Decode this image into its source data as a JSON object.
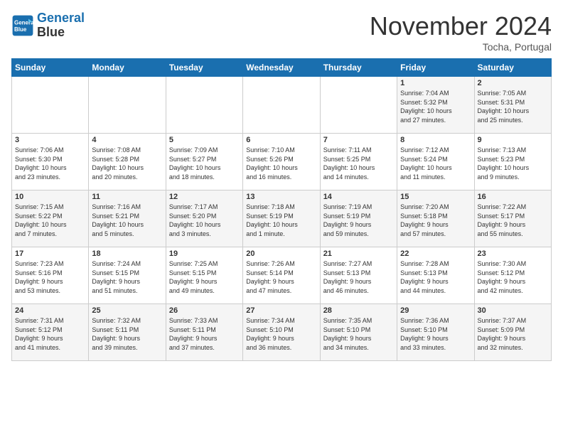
{
  "logo": {
    "line1": "General",
    "line2": "Blue"
  },
  "title": "November 2024",
  "location": "Tocha, Portugal",
  "days_of_week": [
    "Sunday",
    "Monday",
    "Tuesday",
    "Wednesday",
    "Thursday",
    "Friday",
    "Saturday"
  ],
  "weeks": [
    [
      {
        "day": "",
        "info": ""
      },
      {
        "day": "",
        "info": ""
      },
      {
        "day": "",
        "info": ""
      },
      {
        "day": "",
        "info": ""
      },
      {
        "day": "",
        "info": ""
      },
      {
        "day": "1",
        "info": "Sunrise: 7:04 AM\nSunset: 5:32 PM\nDaylight: 10 hours\nand 27 minutes."
      },
      {
        "day": "2",
        "info": "Sunrise: 7:05 AM\nSunset: 5:31 PM\nDaylight: 10 hours\nand 25 minutes."
      }
    ],
    [
      {
        "day": "3",
        "info": "Sunrise: 7:06 AM\nSunset: 5:30 PM\nDaylight: 10 hours\nand 23 minutes."
      },
      {
        "day": "4",
        "info": "Sunrise: 7:08 AM\nSunset: 5:28 PM\nDaylight: 10 hours\nand 20 minutes."
      },
      {
        "day": "5",
        "info": "Sunrise: 7:09 AM\nSunset: 5:27 PM\nDaylight: 10 hours\nand 18 minutes."
      },
      {
        "day": "6",
        "info": "Sunrise: 7:10 AM\nSunset: 5:26 PM\nDaylight: 10 hours\nand 16 minutes."
      },
      {
        "day": "7",
        "info": "Sunrise: 7:11 AM\nSunset: 5:25 PM\nDaylight: 10 hours\nand 14 minutes."
      },
      {
        "day": "8",
        "info": "Sunrise: 7:12 AM\nSunset: 5:24 PM\nDaylight: 10 hours\nand 11 minutes."
      },
      {
        "day": "9",
        "info": "Sunrise: 7:13 AM\nSunset: 5:23 PM\nDaylight: 10 hours\nand 9 minutes."
      }
    ],
    [
      {
        "day": "10",
        "info": "Sunrise: 7:15 AM\nSunset: 5:22 PM\nDaylight: 10 hours\nand 7 minutes."
      },
      {
        "day": "11",
        "info": "Sunrise: 7:16 AM\nSunset: 5:21 PM\nDaylight: 10 hours\nand 5 minutes."
      },
      {
        "day": "12",
        "info": "Sunrise: 7:17 AM\nSunset: 5:20 PM\nDaylight: 10 hours\nand 3 minutes."
      },
      {
        "day": "13",
        "info": "Sunrise: 7:18 AM\nSunset: 5:19 PM\nDaylight: 10 hours\nand 1 minute."
      },
      {
        "day": "14",
        "info": "Sunrise: 7:19 AM\nSunset: 5:19 PM\nDaylight: 9 hours\nand 59 minutes."
      },
      {
        "day": "15",
        "info": "Sunrise: 7:20 AM\nSunset: 5:18 PM\nDaylight: 9 hours\nand 57 minutes."
      },
      {
        "day": "16",
        "info": "Sunrise: 7:22 AM\nSunset: 5:17 PM\nDaylight: 9 hours\nand 55 minutes."
      }
    ],
    [
      {
        "day": "17",
        "info": "Sunrise: 7:23 AM\nSunset: 5:16 PM\nDaylight: 9 hours\nand 53 minutes."
      },
      {
        "day": "18",
        "info": "Sunrise: 7:24 AM\nSunset: 5:15 PM\nDaylight: 9 hours\nand 51 minutes."
      },
      {
        "day": "19",
        "info": "Sunrise: 7:25 AM\nSunset: 5:15 PM\nDaylight: 9 hours\nand 49 minutes."
      },
      {
        "day": "20",
        "info": "Sunrise: 7:26 AM\nSunset: 5:14 PM\nDaylight: 9 hours\nand 47 minutes."
      },
      {
        "day": "21",
        "info": "Sunrise: 7:27 AM\nSunset: 5:13 PM\nDaylight: 9 hours\nand 46 minutes."
      },
      {
        "day": "22",
        "info": "Sunrise: 7:28 AM\nSunset: 5:13 PM\nDaylight: 9 hours\nand 44 minutes."
      },
      {
        "day": "23",
        "info": "Sunrise: 7:30 AM\nSunset: 5:12 PM\nDaylight: 9 hours\nand 42 minutes."
      }
    ],
    [
      {
        "day": "24",
        "info": "Sunrise: 7:31 AM\nSunset: 5:12 PM\nDaylight: 9 hours\nand 41 minutes."
      },
      {
        "day": "25",
        "info": "Sunrise: 7:32 AM\nSunset: 5:11 PM\nDaylight: 9 hours\nand 39 minutes."
      },
      {
        "day": "26",
        "info": "Sunrise: 7:33 AM\nSunset: 5:11 PM\nDaylight: 9 hours\nand 37 minutes."
      },
      {
        "day": "27",
        "info": "Sunrise: 7:34 AM\nSunset: 5:10 PM\nDaylight: 9 hours\nand 36 minutes."
      },
      {
        "day": "28",
        "info": "Sunrise: 7:35 AM\nSunset: 5:10 PM\nDaylight: 9 hours\nand 34 minutes."
      },
      {
        "day": "29",
        "info": "Sunrise: 7:36 AM\nSunset: 5:10 PM\nDaylight: 9 hours\nand 33 minutes."
      },
      {
        "day": "30",
        "info": "Sunrise: 7:37 AM\nSunset: 5:09 PM\nDaylight: 9 hours\nand 32 minutes."
      }
    ]
  ]
}
